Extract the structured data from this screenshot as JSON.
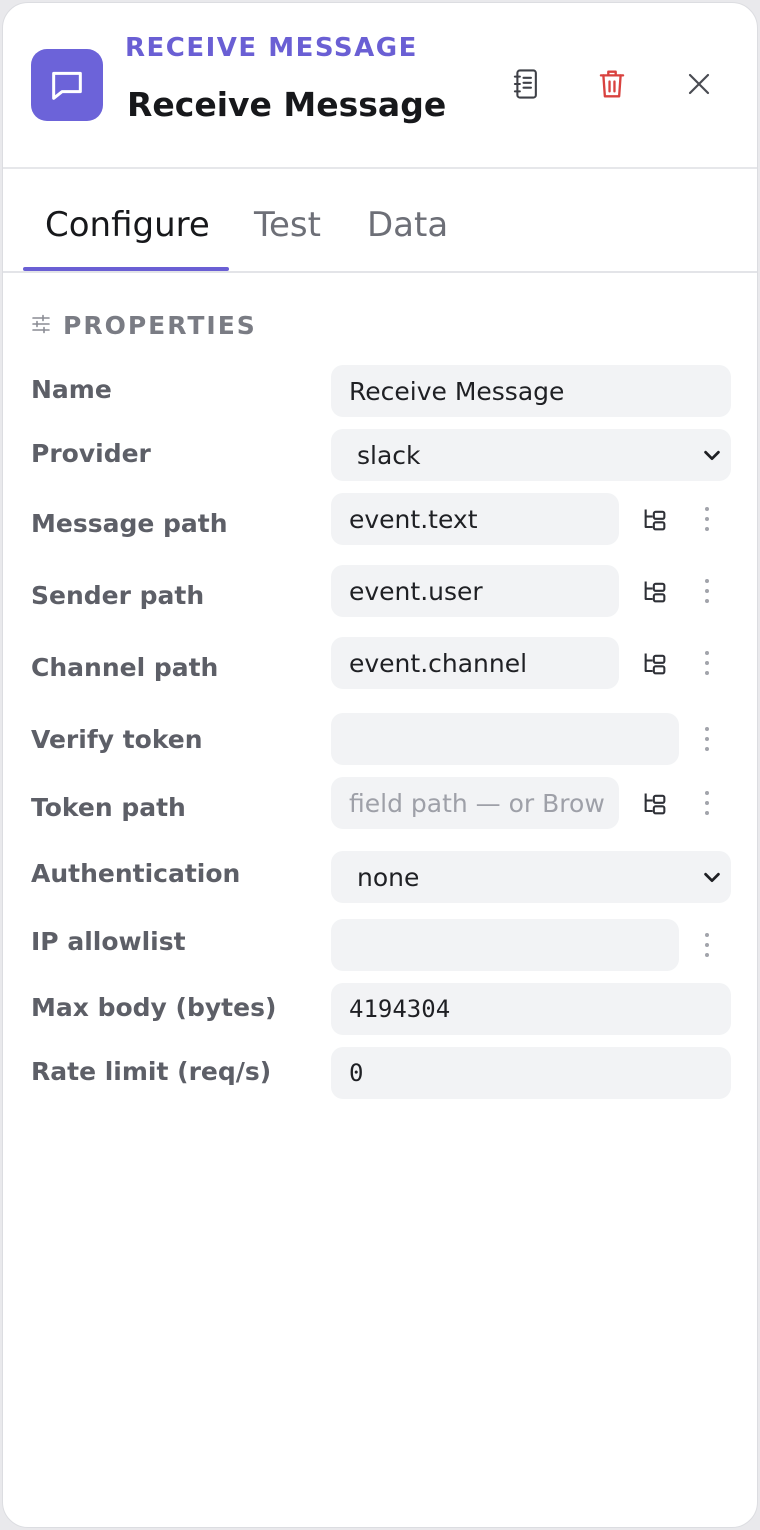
{
  "header": {
    "eyebrow": "RECEIVE MESSAGE",
    "title": "Receive Message",
    "icons": {
      "node": "chat-bubble-icon",
      "docs": "notebook-icon",
      "delete": "trash-icon",
      "close": "close-icon"
    },
    "colors": {
      "accent": "#6a5fd4",
      "danger": "#d9423f"
    }
  },
  "tabs": [
    {
      "label": "Configure",
      "active": true
    },
    {
      "label": "Test",
      "active": false
    },
    {
      "label": "Data",
      "active": false
    }
  ],
  "section": {
    "title": "PROPERTIES",
    "icon": "sliders-icon"
  },
  "fields": {
    "name": {
      "label": "Name",
      "value": "Receive Message"
    },
    "provider": {
      "label": "Provider",
      "value": "slack"
    },
    "message_path": {
      "label": "Message path",
      "value": "event.text"
    },
    "sender_path": {
      "label": "Sender path",
      "value": "event.user"
    },
    "channel_path": {
      "label": "Channel path",
      "value": "event.channel"
    },
    "verify_token": {
      "label": "Verify token",
      "value": ""
    },
    "token_path": {
      "label": "Token path",
      "value": "",
      "placeholder": "field path — or Brow"
    },
    "authentication": {
      "label": "Authentication",
      "value": "none"
    },
    "ip_allowlist": {
      "label": "IP allowlist",
      "value": ""
    },
    "max_body": {
      "label": "Max body (bytes)",
      "value": "4194304"
    },
    "rate_limit": {
      "label": "Rate limit (req/s)",
      "value": "0"
    }
  }
}
